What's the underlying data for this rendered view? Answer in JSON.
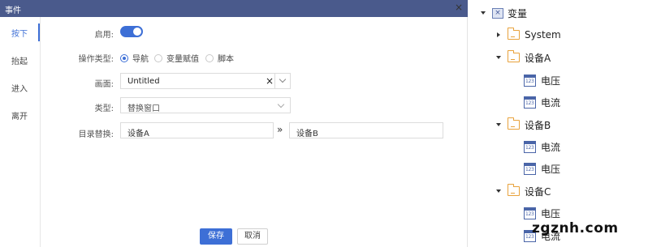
{
  "dialog": {
    "title": "事件",
    "close": "×",
    "tabs": [
      "按下",
      "抬起",
      "进入",
      "离开"
    ],
    "enable": {
      "label": "启用:",
      "on": true
    },
    "op_type": {
      "label": "操作类型:",
      "options": [
        "导航",
        "变量赋值",
        "脚本"
      ],
      "selected": "导航"
    },
    "screen": {
      "label": "画面:",
      "value": "Untitled",
      "clear": "×"
    },
    "type": {
      "label": "类型:",
      "value": "替换窗口"
    },
    "dir_replace": {
      "label": "目录替换:",
      "from": "设备A",
      "arrow": "»",
      "to": "设备B"
    },
    "save": "保存",
    "cancel": "取消"
  },
  "tree": {
    "root": {
      "label": "变量",
      "icon": "variable-box-icon",
      "expanded": true
    },
    "items": [
      {
        "label": "System",
        "icon": "folder-icon",
        "expanded": false
      },
      {
        "label": "设备A",
        "icon": "folder-icon",
        "expanded": true,
        "children": [
          "电压",
          "电流"
        ]
      },
      {
        "label": "设备B",
        "icon": "folder-icon",
        "expanded": true,
        "children": [
          "电流",
          "电压"
        ]
      },
      {
        "label": "设备C",
        "icon": "folder-icon",
        "expanded": true,
        "children": [
          "电压",
          "电流"
        ]
      }
    ],
    "num_icon_text": "123"
  },
  "watermark": "zgznh.com"
}
